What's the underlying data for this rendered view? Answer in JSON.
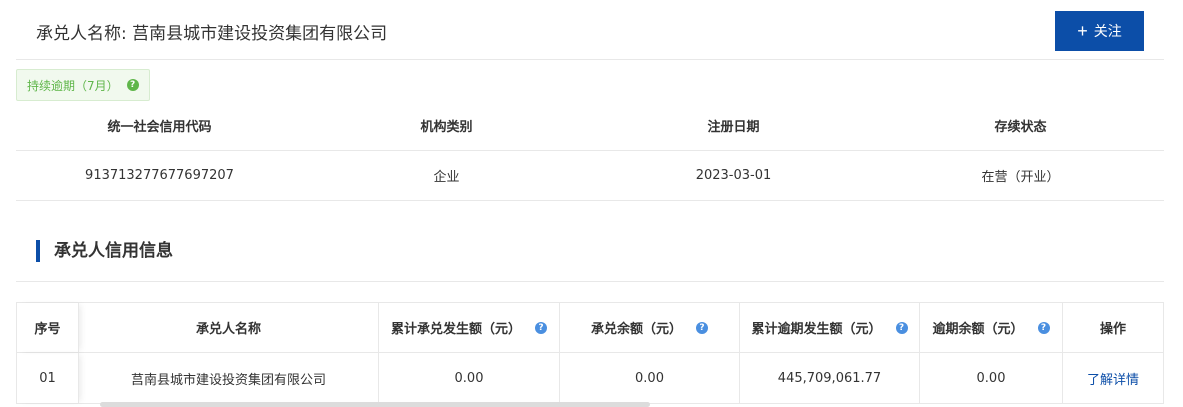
{
  "header": {
    "title": "承兑人名称: 莒南县城市建设投资集团有限公司",
    "follow_label": "关注",
    "follow_icon": "plus-icon"
  },
  "status_badge": {
    "label": "持续逾期（7月）",
    "icon": "question-icon"
  },
  "info": {
    "headers": [
      "统一社会信用代码",
      "机构类别",
      "注册日期",
      "存续状态"
    ],
    "values": [
      "913713277677697207",
      "企业",
      "2023-03-01",
      "在营（开业）"
    ]
  },
  "section": {
    "title": "承兑人信用信息"
  },
  "credit_table": {
    "headers": [
      "序号",
      "承兑人名称",
      "累计承兑发生额（元）",
      "承兑余额（元）",
      "累计逾期发生额（元）",
      "逾期余额（元）",
      "操作"
    ],
    "rows": [
      [
        "01",
        "莒南县城市建设投资集团有限公司",
        "0.00",
        "0.00",
        "445,709,061.77",
        "0.00",
        "了解详情"
      ]
    ]
  },
  "colors": {
    "accent": "#0c4ea8",
    "badge_green": "#5fb64a",
    "info_blue": "#4a8fe0"
  }
}
